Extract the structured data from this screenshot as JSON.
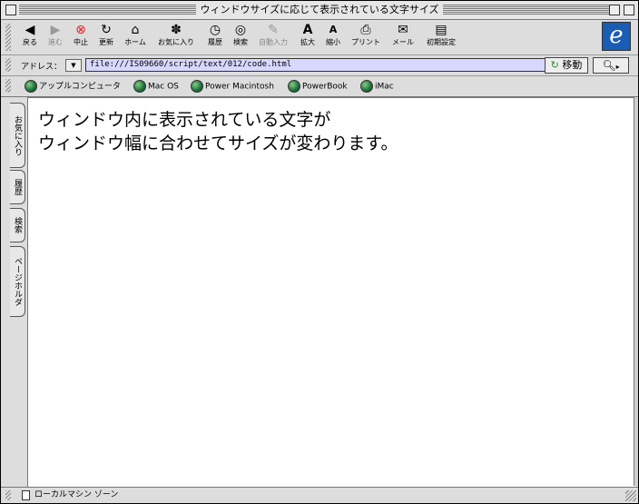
{
  "window": {
    "title": "ウィンドウサイズに応じて表示されている文字サイズ"
  },
  "toolbar": {
    "buttons": [
      {
        "label": "戻る",
        "icon": "back-arrow-icon",
        "enabled": true
      },
      {
        "label": "進む",
        "icon": "forward-arrow-icon",
        "enabled": false
      },
      {
        "label": "中止",
        "icon": "stop-icon",
        "enabled": true
      },
      {
        "label": "更新",
        "icon": "refresh-icon",
        "enabled": true
      },
      {
        "label": "ホーム",
        "icon": "home-icon",
        "enabled": true
      },
      {
        "label": "お気に入り",
        "icon": "favorites-icon",
        "enabled": true
      },
      {
        "label": "履歴",
        "icon": "history-icon",
        "enabled": true
      },
      {
        "label": "検索",
        "icon": "search-icon",
        "enabled": true
      },
      {
        "label": "自動入力",
        "icon": "autofill-icon",
        "enabled": false
      },
      {
        "label": "拡大",
        "icon": "text-larger-icon",
        "enabled": true
      },
      {
        "label": "縮小",
        "icon": "text-smaller-icon",
        "enabled": true
      },
      {
        "label": "プリント",
        "icon": "print-icon",
        "enabled": true
      },
      {
        "label": "メール",
        "icon": "mail-icon",
        "enabled": true
      },
      {
        "label": "初期設定",
        "icon": "preferences-icon",
        "enabled": true
      }
    ],
    "brand_logo_letter": "e"
  },
  "address": {
    "label": "アドレス：",
    "url": "file:///IS09660/script/text/012/code.html",
    "go_label": "移動"
  },
  "favorites": [
    {
      "label": "アップルコンピュータ"
    },
    {
      "label": "Mac OS"
    },
    {
      "label": "Power Macintosh"
    },
    {
      "label": "PowerBook"
    },
    {
      "label": "iMac"
    }
  ],
  "side_tabs": [
    {
      "label": "お気に入り"
    },
    {
      "label": "履歴"
    },
    {
      "label": "検索"
    },
    {
      "label": "ページホルダ"
    }
  ],
  "content": {
    "line1": "ウィンドウ内に表示されている文字が",
    "line2": "ウィンドウ幅に合わせてサイズが変わります。"
  },
  "status": {
    "text": "ローカルマシン ゾーン"
  },
  "colors": {
    "chrome": "#dddddd",
    "address_field": "#d8d8ff",
    "content_bg": "#ffffff",
    "ie_logo": "#1a5db5"
  }
}
